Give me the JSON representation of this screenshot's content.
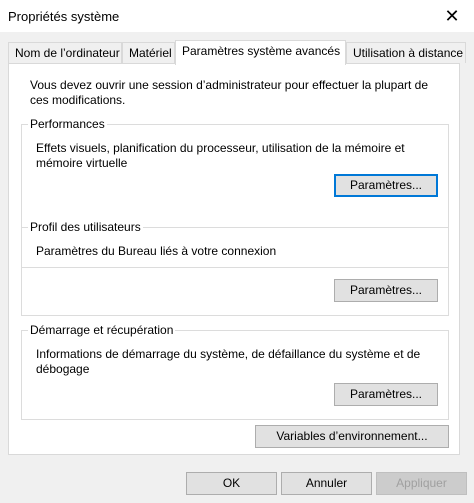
{
  "window": {
    "title": "Propriétés système",
    "close_glyph": "✕"
  },
  "tabs": [
    {
      "label": "Nom de l’ordinateur"
    },
    {
      "label": "Matériel"
    },
    {
      "label": "Paramètres système avancés"
    },
    {
      "label": "Utilisation à distance"
    }
  ],
  "panel": {
    "intro": "Vous devez ouvrir une session d’administrateur pour effectuer la plupart de ces modifications.",
    "performance": {
      "title": "Performances",
      "description": "Effets visuels, planification du processeur, utilisation de la mémoire et mémoire virtuelle",
      "button_label": "Paramètres...",
      "button_mnemonic": "P"
    },
    "user_profiles": {
      "title": "Profil des utilisateurs",
      "description": "Paramètres du Bureau liés à votre connexion",
      "button_label": "Paramètres...",
      "button_mnemonic": "a"
    },
    "startup_recovery": {
      "title": "Démarrage et récupération",
      "description": "Informations de démarrage du système, de défaillance du système et de débogage",
      "button_label": "Paramètres...",
      "button_mnemonic": "t"
    },
    "env_button_label": "Variables d’environnement..."
  },
  "footer": {
    "ok_label": "OK",
    "cancel_label": "Annuler",
    "apply_label": "Appliquer"
  },
  "colors": {
    "focus_border": "#0078d7",
    "disabled_text": "#a0a0a0"
  }
}
